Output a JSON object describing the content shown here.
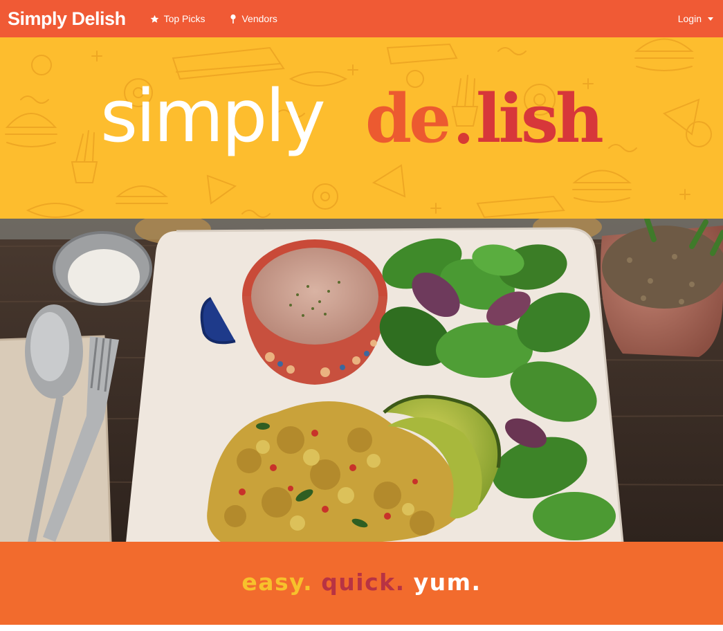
{
  "navbar": {
    "brand": "Simply Delish",
    "top_picks": "Top Picks",
    "vendors": "Vendors",
    "login": "Login",
    "icons": [
      "star-icon",
      "map-pin-icon",
      "caret-down-icon"
    ]
  },
  "banner": {
    "logo_part1": "simply",
    "logo_part2": "de",
    "logo_part3": "lish"
  },
  "hero": {
    "image_alt": "Tofu scramble breakfast plate with soup, avocado and salad greens"
  },
  "tagline": {
    "word1": "easy.",
    "word2": "quick.",
    "word3": "yum."
  },
  "colors": {
    "nav": "#f05a35",
    "banner": "#fdbd2e",
    "tagline_bg": "#f26b2d",
    "accent_yellow": "#f7c12c",
    "accent_maroon": "#b83343",
    "logo_orange": "#ec5a30",
    "logo_red": "#d7373a"
  }
}
